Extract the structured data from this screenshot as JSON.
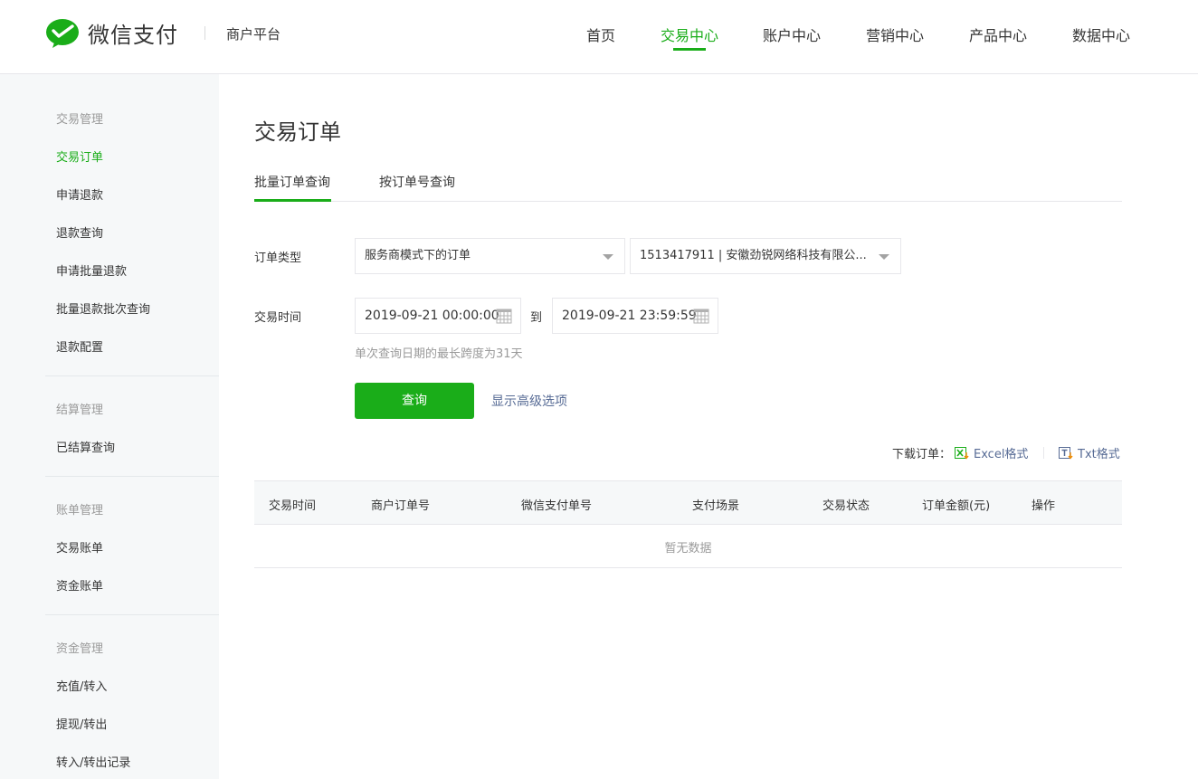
{
  "header": {
    "logo_text": "微信支付",
    "platform": "商户平台",
    "nav": [
      "首页",
      "交易中心",
      "账户中心",
      "营销中心",
      "产品中心",
      "数据中心"
    ],
    "active_nav": "交易中心",
    "accent_color": "#1aad19"
  },
  "sidebar": {
    "groups": [
      {
        "title": "交易管理",
        "items": [
          "交易订单",
          "申请退款",
          "退款查询",
          "申请批量退款",
          "批量退款批次查询",
          "退款配置"
        ]
      },
      {
        "title": "结算管理",
        "items": [
          "已结算查询"
        ]
      },
      {
        "title": "账单管理",
        "items": [
          "交易账单",
          "资金账单"
        ]
      },
      {
        "title": "资金管理",
        "items": [
          "充值/转入",
          "提现/转出",
          "转入/转出记录"
        ]
      }
    ],
    "active_item": "交易订单"
  },
  "main": {
    "title": "交易订单",
    "tabs": [
      "批量订单查询",
      "按订单号查询"
    ],
    "active_tab": "批量订单查询",
    "form": {
      "order_type_label": "订单类型",
      "order_type_value": "服务商模式下的订单",
      "merchant_value": "1513417911 | 安徽劲锐网络科技有限公...",
      "time_label": "交易时间",
      "start_time": "2019-09-21 00:00:00",
      "to_label": "到",
      "end_time": "2019-09-21 23:59:59",
      "hint": "单次查询日期的最长跨度为31天",
      "query_button": "查询",
      "advanced_link": "显示高级选项"
    },
    "download": {
      "label": "下载订单：",
      "excel": "Excel格式",
      "txt": "Txt格式"
    },
    "table": {
      "columns": [
        "交易时间",
        "商户订单号",
        "微信支付单号",
        "支付场景",
        "交易状态",
        "订单金额(元)",
        "操作"
      ],
      "empty_text": "暂无数据"
    }
  }
}
